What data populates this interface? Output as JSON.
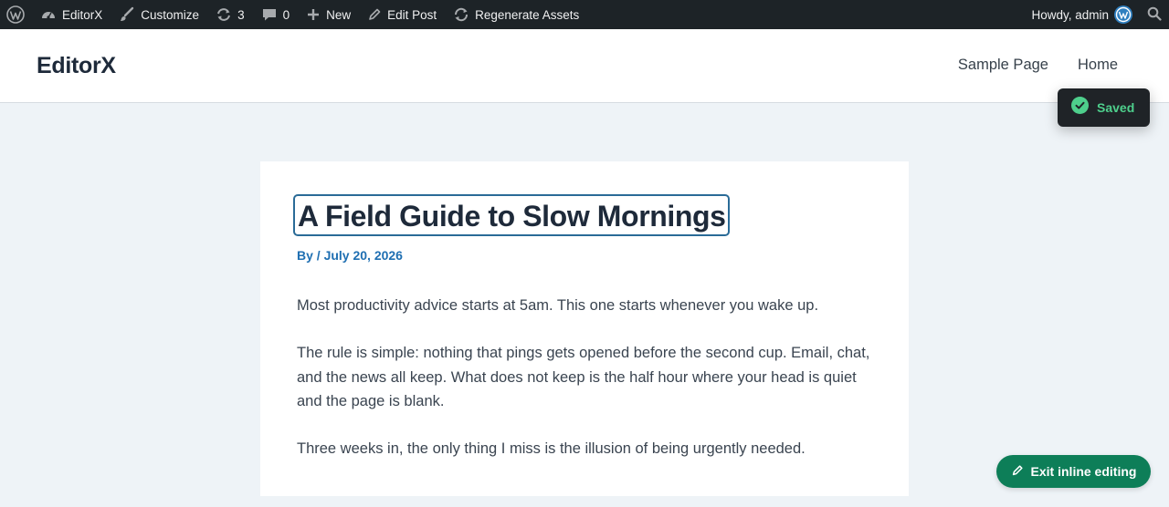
{
  "adminbar": {
    "site_name": "EditorX",
    "customize": "Customize",
    "updates_count": "3",
    "comments_count": "0",
    "new": "New",
    "edit_post": "Edit Post",
    "regenerate": "Regenerate Assets",
    "howdy": "Howdy, admin",
    "icons": [
      "wordpress-logo-icon",
      "dashboard-icon",
      "brush-icon",
      "updates-icon",
      "comment-icon",
      "plus-icon",
      "pencil-icon",
      "refresh-icon",
      "avatar-icon",
      "search-icon"
    ]
  },
  "header": {
    "site_title": "EditorX",
    "nav": [
      "Sample Page",
      "Home"
    ]
  },
  "toast": {
    "text": "Saved",
    "icon": "check-circle-icon",
    "color": "#4ecf8c"
  },
  "post": {
    "title": "A Field Guide to Slow Mornings",
    "meta": "By / July 20, 2026",
    "paragraphs": [
      "Most productivity advice starts at 5am. This one starts whenever you wake up.",
      "The rule is simple: nothing that pings gets opened before the second cup. Email, chat, and the news all keep. What does not keep is the half hour where your head is quiet and the page is blank.",
      "Three weeks in, the only thing I miss is the illusion of being urgently needed."
    ]
  },
  "exit_button": {
    "label": "Exit inline editing",
    "icon": "pencil-icon",
    "color": "#0d7e58"
  },
  "colors": {
    "adminbar_bg": "#1d2327",
    "accent_blue": "#1f6fb2",
    "title_outline": "#2a6b97",
    "page_bg": "#eef3f7"
  }
}
